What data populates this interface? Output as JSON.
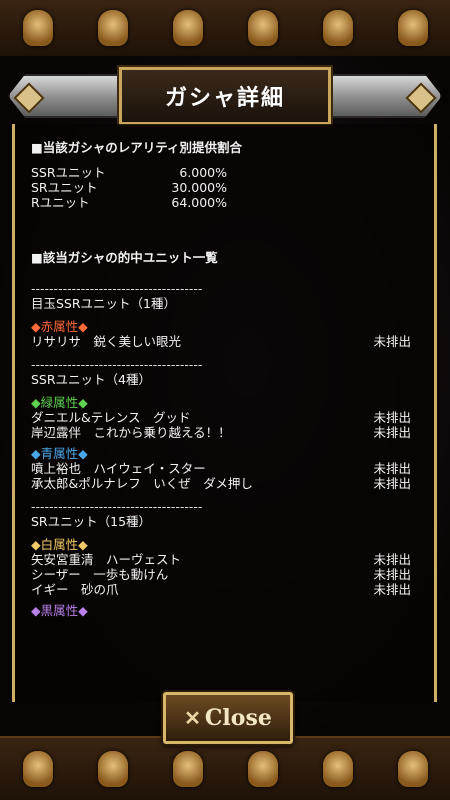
{
  "header": {
    "title": "ガシャ詳細"
  },
  "rates": {
    "title": "■当該ガシャのレアリティ別提供割合",
    "rows": [
      {
        "label": "SSRユニット",
        "value": "6.000%"
      },
      {
        "label": "SRユニット",
        "value": "30.000%"
      },
      {
        "label": "Rユニット",
        "value": "64.000%"
      }
    ]
  },
  "units": {
    "title": "■該当ガシャの的中ユニット一覧",
    "divider": "--------------------------------------",
    "featured_label": "目玉SSRユニット（1種）",
    "red_attr": "◆赤属性◆",
    "featured_units": [
      {
        "name": "リサリサ　鋭く美しい眼光",
        "status": "未排出"
      }
    ],
    "ssr_label": "SSRユニット（4種）",
    "green_attr": "◆緑属性◆",
    "green_units": [
      {
        "name": "ダニエル&テレンス　グッド",
        "status": "未排出"
      },
      {
        "name": "岸辺露伴　これから乗り越える！！",
        "status": "未排出"
      }
    ],
    "blue_attr": "◆青属性◆",
    "blue_units": [
      {
        "name": "噴上裕也　ハイウェイ・スター",
        "status": "未排出"
      },
      {
        "name": "承太郎&ポルナレフ　いくぜ　ダメ押し",
        "status": "未排出"
      }
    ],
    "sr_label": "SRユニット（15種）",
    "white_attr": "◆白属性◆",
    "white_units": [
      {
        "name": "矢安宮重清　ハーヴェスト",
        "status": "未排出"
      },
      {
        "name": "シーザー　一歩も動けん",
        "status": "未排出"
      },
      {
        "name": "イギー　砂の爪",
        "status": "未排出"
      }
    ],
    "black_attr": "◆黒属性◆"
  },
  "close_button": {
    "icon": "close-x-icon",
    "label": "Close"
  },
  "colors": {
    "accent_gold": "#cfae66",
    "red_attr": "#ff6a3a",
    "green_attr": "#5fd04f",
    "blue_attr": "#4aa6e8",
    "white_attr": "#f0c868",
    "black_attr": "#b880e8"
  }
}
